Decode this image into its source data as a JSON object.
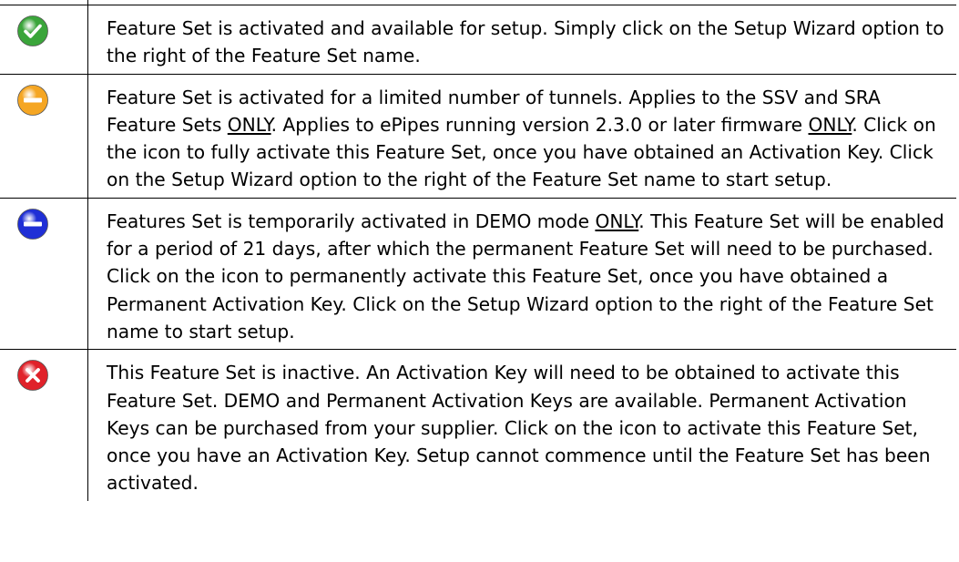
{
  "rows": [
    {
      "icon": "check-circle-icon",
      "color": "#3aa53a",
      "segments": [
        {
          "text": "Feature Set is activated and available for setup.  Simply click on the Setup Wizard option to the right of the Feature Set name.",
          "u": false
        }
      ]
    },
    {
      "icon": "minus-circle-orange-icon",
      "color": "#f5a623",
      "segments": [
        {
          "text": "Feature Set is activated for a limited number of tunnels.  Applies to the SSV and SRA Feature Sets ",
          "u": false
        },
        {
          "text": "ONLY",
          "u": true
        },
        {
          "text": ".  Applies to ePipes running version 2.3.0 or later firmware ",
          "u": false
        },
        {
          "text": "ONLY",
          "u": true
        },
        {
          "text": ".  Click on the icon to fully activate this Feature Set, once you have obtained an Activation Key.  Click on the Setup Wizard option to the right of the Feature Set name to start setup.",
          "u": false
        }
      ]
    },
    {
      "icon": "minus-circle-blue-icon",
      "color": "#1f2fd6",
      "segments": [
        {
          "text": "Features Set is temporarily activated in DEMO mode ",
          "u": false
        },
        {
          "text": "ONLY",
          "u": true
        },
        {
          "text": ".  This Feature Set will be enabled for a period of 21 days, after which the permanent Feature Set will need to be purchased.  Click on the icon to permanently activate this Feature Set, once you have obtained a Permanent Activation Key.  Click on the Setup Wizard option to the right of the Feature Set name to start setup.",
          "u": false
        }
      ]
    },
    {
      "icon": "x-circle-icon",
      "color": "#e0222a",
      "segments": [
        {
          "text": "This Feature Set is inactive.  An Activation Key will need to be obtained to activate this Feature Set.  DEMO and Permanent Activation Keys are available.  Permanent Activation Keys can be purchased from your supplier.  Click on the icon to activate this Feature Set, once you have an Activation Key.  Setup cannot commence until the Feature Set has been activated.",
          "u": false
        }
      ]
    }
  ]
}
